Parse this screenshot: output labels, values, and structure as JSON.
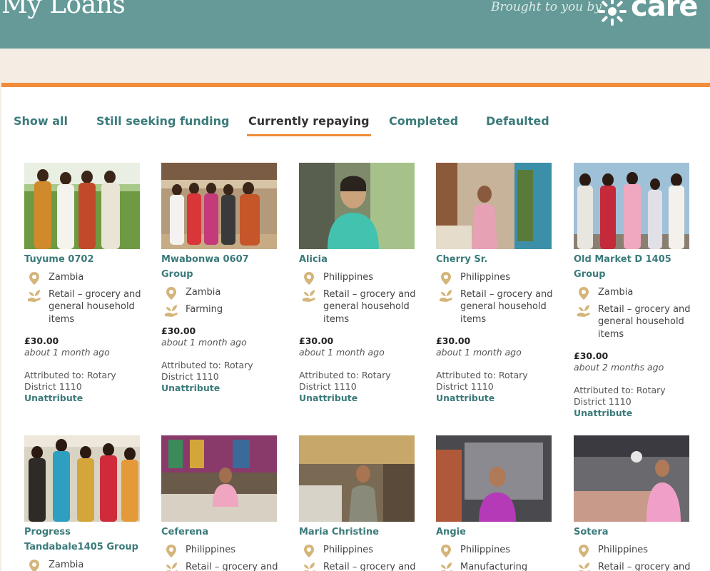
{
  "header": {
    "title": "My Loans",
    "brought_by": "Brought to you by",
    "logo_text": "care"
  },
  "tabs": [
    {
      "label": "Show all",
      "active": false
    },
    {
      "label": "Still seeking funding",
      "active": false
    },
    {
      "label": "Currently repaying",
      "active": true
    },
    {
      "label": "Completed",
      "active": false
    },
    {
      "label": "Defaulted",
      "active": false
    }
  ],
  "loans": [
    {
      "name": "Tuyume 0702",
      "country": "Zambia",
      "sector": "Retail – grocery and general household items",
      "amount": "£30.00",
      "ago": "about 1 month ago",
      "attributed": "Attributed to: Rotary District 1110",
      "unattribute": "Unattribute"
    },
    {
      "name": "Mwabonwa 0607 Group",
      "country": "Zambia",
      "sector": "Farming",
      "amount": "£30.00",
      "ago": "about 1 month ago",
      "attributed": "Attributed to: Rotary District 1110",
      "unattribute": "Unattribute"
    },
    {
      "name": "Alicia",
      "country": "Philippines",
      "sector": "Retail – grocery and general household items",
      "amount": "£30.00",
      "ago": "about 1 month ago",
      "attributed": "Attributed to: Rotary District 1110",
      "unattribute": "Unattribute"
    },
    {
      "name": "Cherry Sr.",
      "country": "Philippines",
      "sector": "Retail – grocery and general household items",
      "amount": "£30.00",
      "ago": "about 1 month ago",
      "attributed": "Attributed to: Rotary District 1110",
      "unattribute": "Unattribute"
    },
    {
      "name": "Old Market D 1405 Group",
      "country": "Zambia",
      "sector": "Retail – grocery and general household items",
      "amount": "£30.00",
      "ago": "about 2 months ago",
      "attributed": "Attributed to: Rotary District 1110",
      "unattribute": "Unattribute"
    },
    {
      "name": "Progress Tandabale1405 Group",
      "country": "Zambia",
      "sector": ""
    },
    {
      "name": "Ceferena",
      "country": "Philippines",
      "sector": "Retail – grocery and"
    },
    {
      "name": "Maria Christine",
      "country": "Philippines",
      "sector": "Retail – grocery and"
    },
    {
      "name": "Angie",
      "country": "Philippines",
      "sector": "Manufacturing"
    },
    {
      "name": "Sotera",
      "country": "Philippines",
      "sector": "Retail – grocery and"
    }
  ],
  "colors": {
    "teal": "#659a98",
    "accent": "#f08c3a",
    "link": "#3b7a7a",
    "icon": "#d4b57a"
  }
}
